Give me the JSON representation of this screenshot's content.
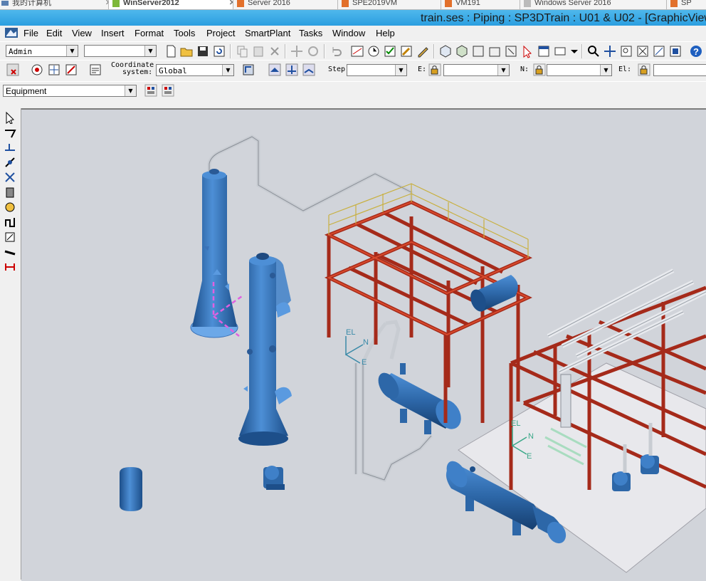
{
  "browser_tabs": [
    {
      "label": "我的计算机",
      "active": false
    },
    {
      "label": "WinServer2012",
      "active": true
    },
    {
      "label": "Server 2016",
      "active": false
    },
    {
      "label": "SPE2019VM",
      "active": false
    },
    {
      "label": "VM191",
      "active": false
    },
    {
      "label": "Windows Server 2016",
      "active": false
    },
    {
      "label": "SP",
      "active": false
    }
  ],
  "window": {
    "title": "train.ses : Piping : SP3DTrain : U01 & U02 - [GraphicView"
  },
  "menu": [
    "File",
    "Edit",
    "View",
    "Insert",
    "Format",
    "Tools",
    "Project",
    "SmartPlant",
    "Tasks",
    "Window",
    "Help"
  ],
  "toolbar1": {
    "permission_combo": "Admin",
    "second_combo": ""
  },
  "toolbar2": {
    "coordinate_label_1": "Coordinate",
    "coordinate_label_2": "system:",
    "coordinate_combo": "Global",
    "step_label": "Step:",
    "step_value": "",
    "e_label": "E:",
    "e_value": "",
    "n_label": "N:",
    "n_value": "",
    "el_label": "El:",
    "el_value": ""
  },
  "toolbar3": {
    "locate_filter": "Equipment"
  },
  "viewport": {
    "background": "#d1d4da",
    "equipment_color": "#2f6aa8",
    "structure_color": "#a52a1a",
    "pipe_color": "#d8dce2",
    "axis_labels_1": {
      "el": "EL",
      "n": "N",
      "e": "E"
    },
    "axis_labels_2": {
      "el": "EL",
      "n": "N",
      "e": "E"
    }
  }
}
